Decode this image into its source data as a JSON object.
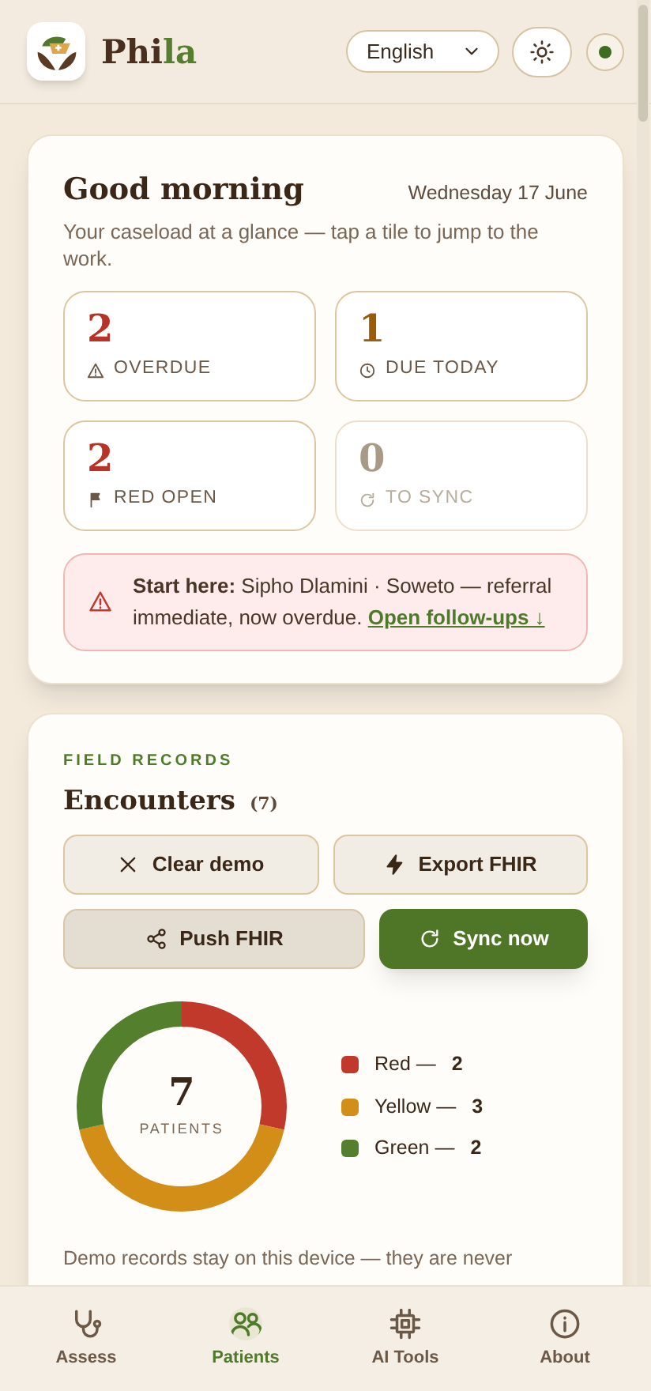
{
  "header": {
    "brand_main": "Phi",
    "brand_accent": "la",
    "language": "English",
    "online": true
  },
  "greeting": {
    "title": "Good morning",
    "date": "Wednesday 17 June",
    "subtitle": "Your caseload at a glance — tap a tile to jump to the work.",
    "tiles": [
      {
        "value": "2",
        "label": "OVERDUE",
        "color": "#b83227",
        "disabled": false
      },
      {
        "value": "1",
        "label": "DUE TODAY",
        "color": "#9a5c0a",
        "disabled": false
      },
      {
        "value": "2",
        "label": "RED OPEN",
        "color": "#b83227",
        "disabled": false
      },
      {
        "value": "0",
        "label": "TO SYNC",
        "color": "#a89a86",
        "disabled": true
      }
    ],
    "alert": {
      "text": "**Start here:** Sipho Dlamini · Soweto — referral immediate, now overdue.",
      "link": "Open follow-ups ↓"
    }
  },
  "records": {
    "eyebrow": "FIELD RECORDS",
    "title": "Encounters",
    "count": "(7)",
    "buttons": [
      {
        "label": "Clear demo",
        "kind": "outline"
      },
      {
        "label": "Export FHIR",
        "kind": "outline"
      },
      {
        "label": "Push FHIR",
        "kind": "muted"
      },
      {
        "label": "Sync now",
        "kind": "primary"
      }
    ],
    "total": "7",
    "total_label": "PATIENTS",
    "legend": [
      {
        "label": "Red —",
        "value": "2",
        "color": "#c0392b"
      },
      {
        "label": "Yellow —",
        "value": "3",
        "color": "#d38e17"
      },
      {
        "label": "Green —",
        "value": "2",
        "color": "#547f2d"
      }
    ],
    "note": "Demo records stay on this device — they are never"
  },
  "nav": [
    {
      "label": "Assess",
      "selected": false
    },
    {
      "label": "Patients",
      "selected": true
    },
    {
      "label": "AI Tools",
      "selected": false
    },
    {
      "label": "About",
      "selected": false
    }
  ]
}
